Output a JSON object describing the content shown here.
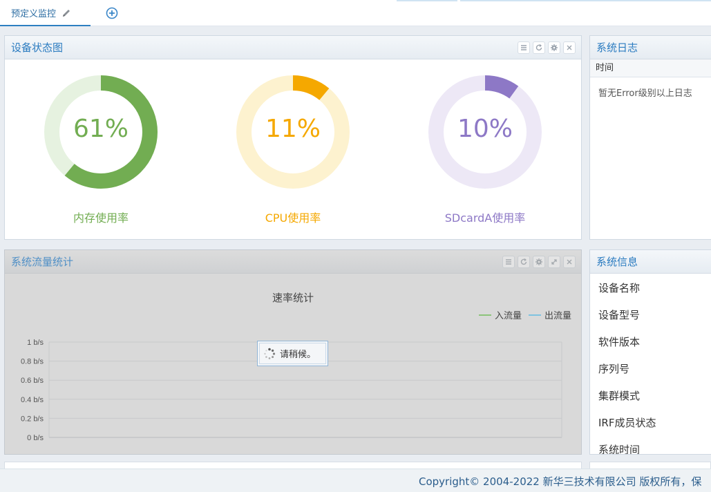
{
  "tabs": {
    "active_label": "预定义监控"
  },
  "device_status": {
    "title": "设备状态图",
    "gauges": [
      {
        "value": 61,
        "text": "61%",
        "label": "内存使用率",
        "color": "#72ad52",
        "track": "#e6f2e0"
      },
      {
        "value": 11,
        "text": "11%",
        "label": "CPU使用率",
        "color": "#f5a800",
        "track": "#fdf2cf"
      },
      {
        "value": 10,
        "text": "10%",
        "label": "SDcardA使用率",
        "color": "#8d78c6",
        "track": "#ede8f6"
      }
    ]
  },
  "traffic": {
    "title": "系统流量统计",
    "loading_text": "请稍候。"
  },
  "chart_data": {
    "type": "line",
    "title": "速率统计",
    "series": [
      {
        "name": "入流量",
        "color": "#8cc47a",
        "values": []
      },
      {
        "name": "出流量",
        "color": "#7ec3e0",
        "values": []
      }
    ],
    "yticks": [
      "1 b/s",
      "0.8 b/s",
      "0.6 b/s",
      "0.4 b/s",
      "0.2 b/s",
      "0 b/s"
    ],
    "ylim": [
      0,
      1
    ]
  },
  "system_log": {
    "title": "系统日志",
    "column_time": "时间",
    "empty_text": "暂无Error级别以上日志"
  },
  "system_info": {
    "title": "系统信息",
    "items": [
      "设备名称",
      "设备型号",
      "软件版本",
      "序列号",
      "集群模式",
      "IRF成员状态",
      "系统时间"
    ]
  },
  "footer": {
    "text": "Copyright© 2004-2022 新华三技术有限公司 版权所有，保"
  }
}
